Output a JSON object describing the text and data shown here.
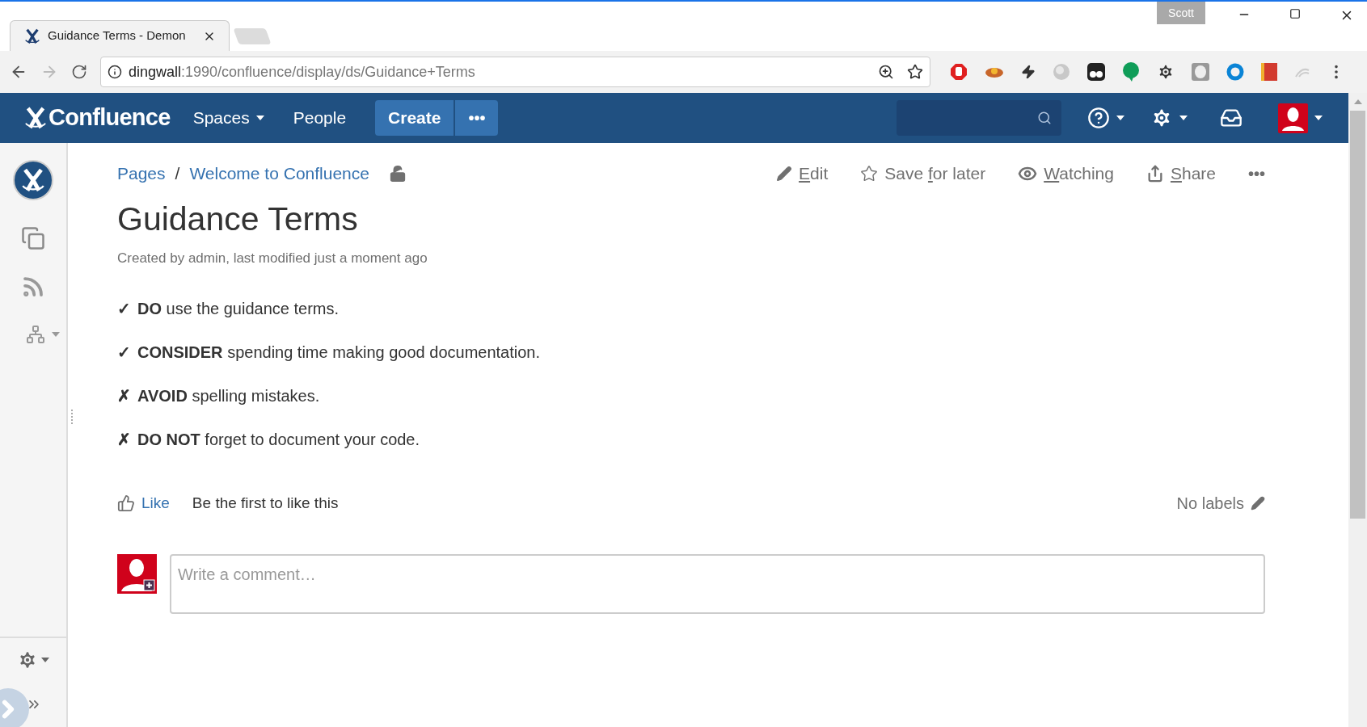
{
  "browser": {
    "tab_title": "Guidance Terms - Demon",
    "user_badge": "Scott",
    "url_host": "dingwall",
    "url_path": ":1990/confluence/display/ds/Guidance+Terms"
  },
  "header": {
    "logo_text": "Confluence",
    "nav": [
      {
        "label": "Spaces",
        "dropdown": true
      },
      {
        "label": "People",
        "dropdown": false
      }
    ],
    "create_label": "Create",
    "more_label": "•••"
  },
  "breadcrumbs": [
    "Pages",
    "Welcome to Confluence"
  ],
  "breadcrumb_separator": "/",
  "actions": [
    {
      "kind": "edit",
      "label": [
        {
          "text": "E",
          "underlined": true
        },
        {
          "text": "dit",
          "underlined": false
        }
      ]
    },
    {
      "kind": "save",
      "label": [
        {
          "text": "Save ",
          "underlined": false
        },
        {
          "text": "f",
          "underlined": true
        },
        {
          "text": "or later",
          "underlined": false
        }
      ]
    },
    {
      "kind": "watch",
      "label": [
        {
          "text": "W",
          "underlined": true
        },
        {
          "text": "atching",
          "underlined": false
        }
      ]
    },
    {
      "kind": "share",
      "label": [
        {
          "text": "S",
          "underlined": true
        },
        {
          "text": "hare",
          "underlined": false
        }
      ]
    }
  ],
  "more_actions": "•••",
  "page": {
    "title": "Guidance Terms",
    "byline": "Created by admin, last modified just a moment ago"
  },
  "items": [
    {
      "mark": "✓",
      "text": "**DO** use the guidance terms."
    },
    {
      "mark": "✓",
      "text": "**CONSIDER** spending time making good documentation."
    },
    {
      "mark": "✗",
      "text": "**AVOID** spelling mistakes."
    },
    {
      "mark": "✗",
      "text": "**DO NOT** forget to document your code."
    }
  ],
  "likes": {
    "label": "Like",
    "text": "Be the first to like this"
  },
  "labels": {
    "text": "No labels"
  },
  "comment": {
    "placeholder": "Write a comment…"
  }
}
